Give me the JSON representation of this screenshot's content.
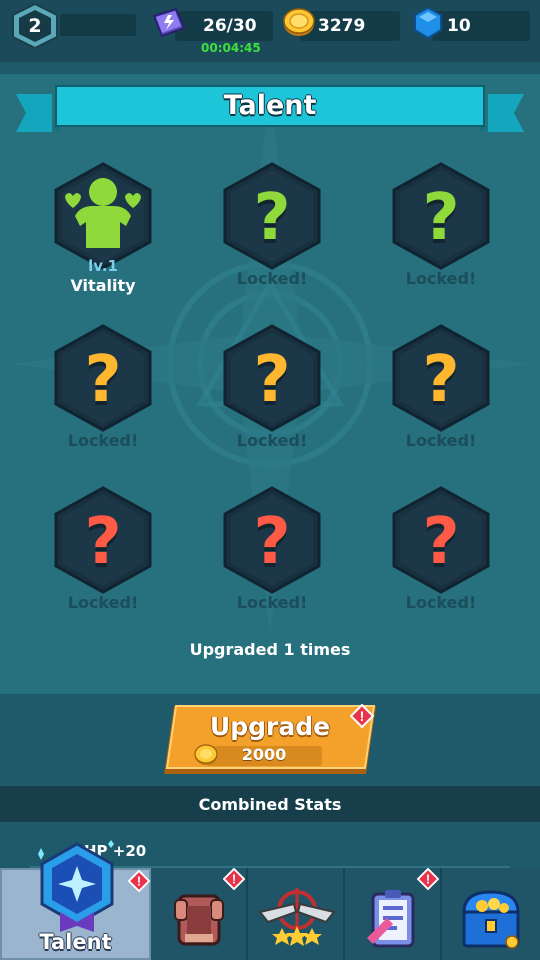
{
  "topbar": {
    "player_level": "2",
    "energy": "26/30",
    "energy_timer": "00:04:45",
    "gold": "3279",
    "gems": "10"
  },
  "talent": {
    "title": "Talent",
    "cells": [
      {
        "state": "unlocked",
        "level": "lv.1",
        "name": "Vitality",
        "icon": "vitality-icon"
      },
      {
        "state": "locked",
        "tier": "green",
        "label": "Locked!"
      },
      {
        "state": "locked",
        "tier": "green",
        "label": "Locked!"
      },
      {
        "state": "locked",
        "tier": "orange",
        "label": "Locked!"
      },
      {
        "state": "locked",
        "tier": "orange",
        "label": "Locked!"
      },
      {
        "state": "locked",
        "tier": "orange",
        "label": "Locked!"
      },
      {
        "state": "locked",
        "tier": "red",
        "label": "Locked!"
      },
      {
        "state": "locked",
        "tier": "red",
        "label": "Locked!"
      },
      {
        "state": "locked",
        "tier": "red",
        "label": "Locked!"
      }
    ],
    "question_mark": "?",
    "upgraded_text": "Upgraded 1 times"
  },
  "upgrade": {
    "label": "Upgrade",
    "cost": "2000",
    "alert": "!"
  },
  "stats": {
    "header": "Combined Stats",
    "lines": [
      "HP +20"
    ]
  },
  "nav": {
    "tabs": [
      {
        "label": "Talent",
        "icon": "talent-badge-icon",
        "active": true,
        "alert": true
      },
      {
        "label": "",
        "icon": "armor-icon",
        "active": false,
        "alert": true
      },
      {
        "label": "",
        "icon": "crossed-guns-icon",
        "active": false,
        "alert": false
      },
      {
        "label": "",
        "icon": "quest-clipboard-icon",
        "active": false,
        "alert": true
      },
      {
        "label": "",
        "icon": "treasure-chest-icon",
        "active": false,
        "alert": false
      }
    ],
    "alert": "!"
  },
  "colors": {
    "tier_green": "#8fd93a",
    "tier_orange": "#ffb730",
    "tier_red": "#ff5a45",
    "banner": "#1ec4d8",
    "upgrade_button": "#f3a12a",
    "timer": "#3de03d"
  }
}
